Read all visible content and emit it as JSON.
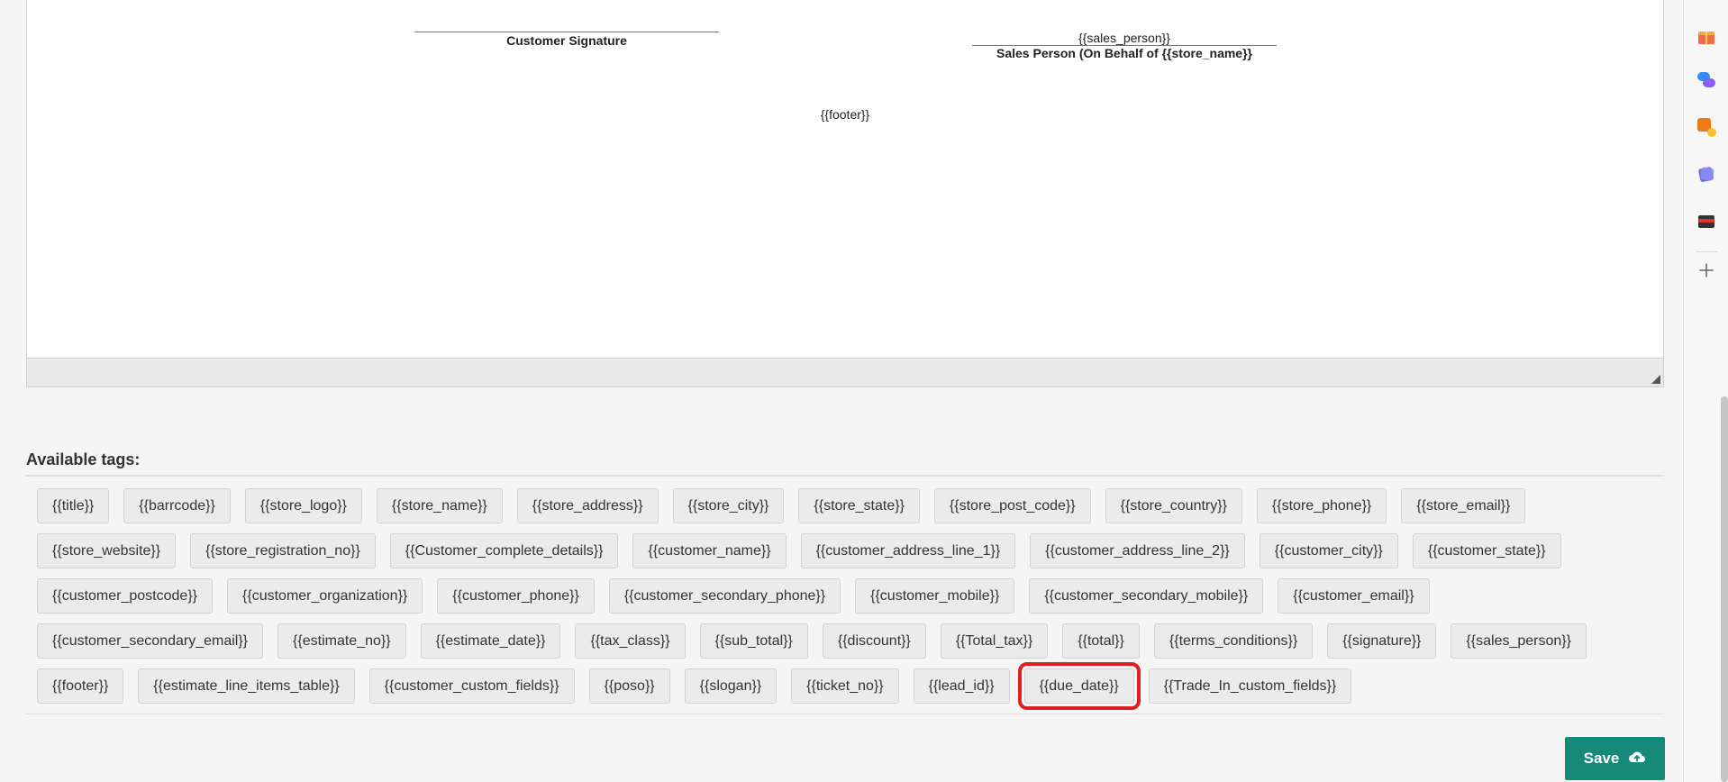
{
  "editor": {
    "customer_signature_label": "Customer Signature",
    "sales_person_value": "{{sales_person}}",
    "sales_person_label": "Sales Person (On Behalf of {{store_name}}",
    "footer_value": "{{footer}}"
  },
  "tags": {
    "title": "Available tags:",
    "rows": [
      [
        "{{title}}",
        "{{barrcode}}",
        "{{store_logo}}",
        "{{store_name}}",
        "{{store_address}}",
        "{{store_city}}",
        "{{store_state}}",
        "{{store_post_code}}",
        "{{store_country}}",
        "{{store_phone}}",
        "{{store_email}}"
      ],
      [
        "{{store_website}}",
        "{{store_registration_no}}",
        "{{Customer_complete_details}}",
        "{{customer_name}}",
        "{{customer_address_line_1}}",
        "{{customer_address_line_2}}",
        "{{customer_city}}",
        "{{customer_state}}"
      ],
      [
        "{{customer_postcode}}",
        "{{customer_organization}}",
        "{{customer_phone}}",
        "{{customer_secondary_phone}}",
        "{{customer_mobile}}",
        "{{customer_secondary_mobile}}",
        "{{customer_email}}"
      ],
      [
        "{{customer_secondary_email}}",
        "{{estimate_no}}",
        "{{estimate_date}}",
        "{{tax_class}}",
        "{{sub_total}}",
        "{{discount}}",
        "{{Total_tax}}",
        "{{total}}",
        "{{terms_conditions}}",
        "{{signature}}",
        "{{sales_person}}"
      ],
      [
        "{{footer}}",
        "{{estimate_line_items_table}}",
        "{{customer_custom_fields}}",
        "{{poso}}",
        "{{slogan}}",
        "{{ticket_no}}",
        "{{lead_id}}",
        "{{due_date}}",
        "{{Trade_In_custom_fields}}"
      ]
    ],
    "highlighted": "{{due_date}}"
  },
  "save_button": {
    "label": "Save",
    "icon": "cloud-upload-icon"
  },
  "sidebar": {
    "icons": [
      "gift-icon",
      "chat-icon",
      "shapes-icon",
      "cards-icon",
      "wallet-icon",
      "plus-icon"
    ]
  },
  "colors": {
    "accent": "#15897a",
    "highlight": "#e02020"
  }
}
